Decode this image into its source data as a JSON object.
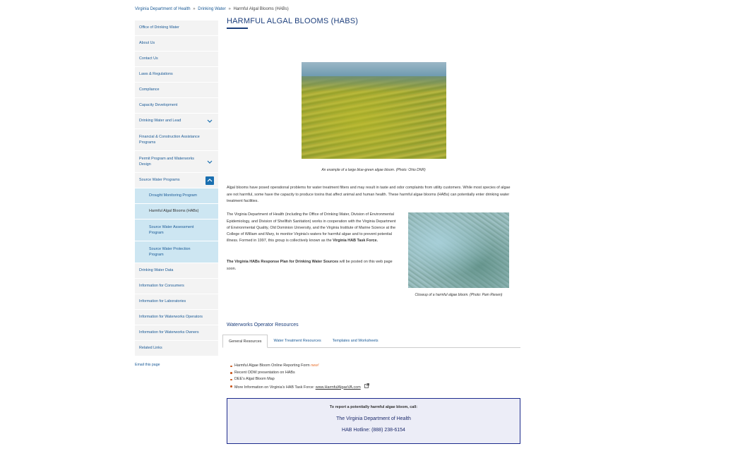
{
  "breadcrumb": {
    "home": "Virginia Department of Health",
    "parent": "Drinking Water",
    "current": "Harmful Algal Blooms (HABs)",
    "separator": "»"
  },
  "sidebar": {
    "items": [
      {
        "label": "Office of Drinking Water"
      },
      {
        "label": "About Us"
      },
      {
        "label": "Contact Us"
      },
      {
        "label": "Laws & Regulations"
      },
      {
        "label": "Compliance"
      },
      {
        "label": "Capacity Development"
      },
      {
        "label": "Drinking Water and Lead"
      },
      {
        "label": "Financial & Construction Assistance Programs"
      },
      {
        "label": "Permit Program and Waterworks Design"
      },
      {
        "label": "Source Water Programs"
      },
      {
        "label": "Drinking Water Data"
      },
      {
        "label": "Information for Consumers"
      },
      {
        "label": "Information for Laboratories"
      },
      {
        "label": "Information for Waterworks Operators"
      },
      {
        "label": "Information for Waterworks Owners"
      },
      {
        "label": "Related Links"
      }
    ],
    "sub_items": [
      {
        "label": "Drought Monitoring Program"
      },
      {
        "label": "Harmful Algal Blooms (HABs)"
      },
      {
        "label": "Source Water Assessment Program"
      },
      {
        "label": "Source Water Protection Program"
      }
    ],
    "email_link": "Email this page"
  },
  "main": {
    "title": "HARMFUL ALGAL BLOOMS (HABS)",
    "caption1": "An example of a large blue-green algae bloom. (Photo: Ohio DNR)",
    "para1": "Algal blooms have posed operational problems for water treatment filters and may result in taste and odor complaints from utility customers. While most species of algae are not harmful, some have the capacity to produce toxins that affect animal and human health. These harmful algae blooms (HABs) can potentially enter drinking water treatment facilities.",
    "para2_start": "The Virginia Department of Health (including the Office of Drinking Water, Division of Environmental Epidemiology, and Division of Shellfish Sanitation) works in cooperation with the Virginia Department of Environmental Quality, Old Dominion University, and the Virginia Institute of Marine Science at the College of William and Mary, to monitor Virginia's waters for harmful algae and to prevent potential illness. Formed in 1997, this group is collectively known as the ",
    "para2_bold": "Virginia HAB Task Force.",
    "para3_bold": "The Virginia HABs Response Plan for Drinking Water Sources",
    "para3_rest": " will be posted on this web page soon.",
    "caption2": "Closeup of  a harmful algae bloom. (Photo: Pam Riesen)",
    "resources_heading": "Waterworks Operator Resources",
    "tabs": [
      {
        "label": "General Resources"
      },
      {
        "label": "Water Treatment Resources"
      },
      {
        "label": "Templates and Worksheets"
      }
    ],
    "resources": {
      "item1": "Harmful Algae Bloom Online Reporting Form",
      "item1_new": "new!",
      "item2": "Recent ODW presentation on HABs",
      "item3": "DEE's Algal Bloom Map",
      "item4_text": "More Information on Virginia's HAB Task Force: ",
      "item4_link": "www.HarmfulAlgaeVA.com"
    },
    "hotline": {
      "prompt": "To report a potentially harmful algae bloom, call:",
      "org": "The Virginia Department of Health",
      "number": "HAB Hotline: (888) 238-6154"
    }
  },
  "colors": {
    "link": "#1a5a96",
    "title": "#1d3f7c",
    "sidebar_bg": "#f3f3f3",
    "subnav_bg": "#cde6f2",
    "accent": "#1a6fb0",
    "hotline_border": "#1d2b8c",
    "new_tag": "#e86e2b"
  },
  "icons": {
    "expand": "chevron-down-icon",
    "collapse": "chevron-up-icon",
    "external": "external-link-icon"
  }
}
